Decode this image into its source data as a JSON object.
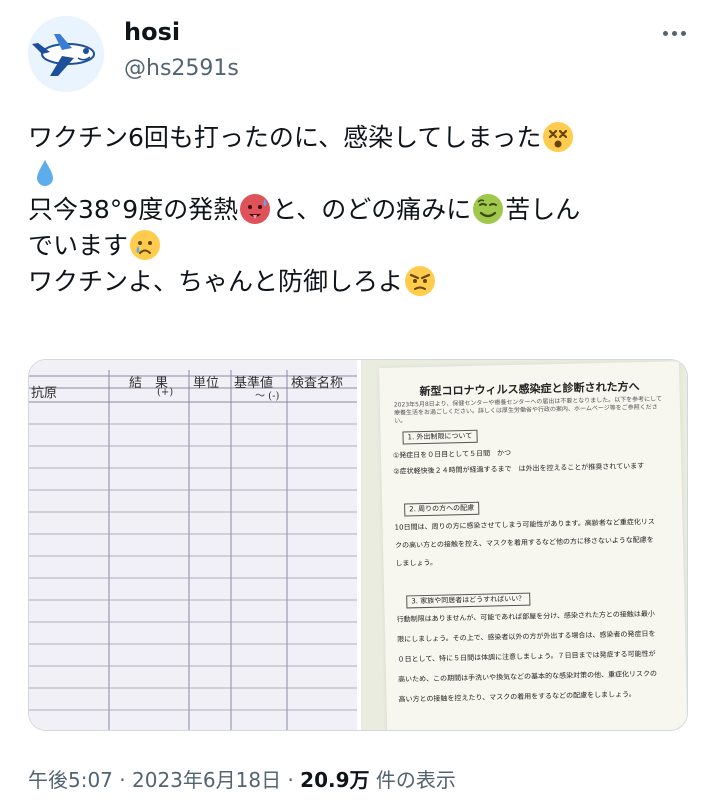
{
  "user": {
    "name": "hosi",
    "handle": "@hs2591s"
  },
  "tweet": {
    "line1": "ワクチン6回も打ったのに、感染してしまった",
    "line3a": "只今38°9度の発熱",
    "line3b": "と、のどの痛みに",
    "line3c": "苦しん",
    "line4": "でいます",
    "line5": "ワクチンよ、ちゃんと防御しろよ"
  },
  "emojis": [
    "dizzy-face",
    "droplet",
    "hot-face",
    "nauseated-face",
    "crying-face",
    "angry-face"
  ],
  "media": {
    "photo1": {
      "headers": [
        "結　果",
        "単位",
        "基準値",
        "検査名称"
      ],
      "row_label": "抗原",
      "result": "(+)",
      "reference": "～ (-)"
    },
    "photo2": {
      "title": "新型コロナウィルス感染症と診断された方へ",
      "intro": "2023年5月8日より、保健センターや療養センターへの届出は不要となりました。以下を参考にして療養生活をお過ごしください。詳しくは厚生労働省や行政の案内、ホームページ等をご参照ください。",
      "s1_heading": "1. 外出制限について",
      "s1_l1": "①発症日を０日目として５日間　かつ",
      "s1_l2": "②症状軽快後２４時間が経過するまで　は外出を控えることが推奨されています",
      "s2_heading": "2. 周りの方への配慮",
      "s2_l1": "10日間は、周りの方に感染させてしまう可能性があります。高齢者など重症化リス",
      "s2_l2": "クの高い方との接触を控え、マスクを着用するなど他の方に移さないような配慮を",
      "s2_l3": "しましょう。",
      "s3_heading": "3. 家族や同居者はどうすればいい？",
      "s3_l1": "行動制限はありませんが、可能であれば部屋を分け、感染された方との接触は最小",
      "s3_l2": "限にしましょう。その上で、感染者以外の方が外出する場合は、感染者の発症日を",
      "s3_l3": "０日として、特に５日間は体調に注意しましょう。７日目までは発症する可能性が",
      "s3_l4": "高いため、この期間は手洗いや換気などの基本的な感染対策の他、重症化リスクの",
      "s3_l5": "高い方との接触を控えたり、マスクの着用をするなどの配慮をしましょう。"
    }
  },
  "meta": {
    "time": "午後5:07",
    "separator": "·",
    "date": "2023年6月18日",
    "views_count": "20.9万",
    "views_label": "件の表示"
  },
  "colors": {
    "text_primary": "#0f1419",
    "text_secondary": "#536471",
    "border": "#cfd9de"
  }
}
